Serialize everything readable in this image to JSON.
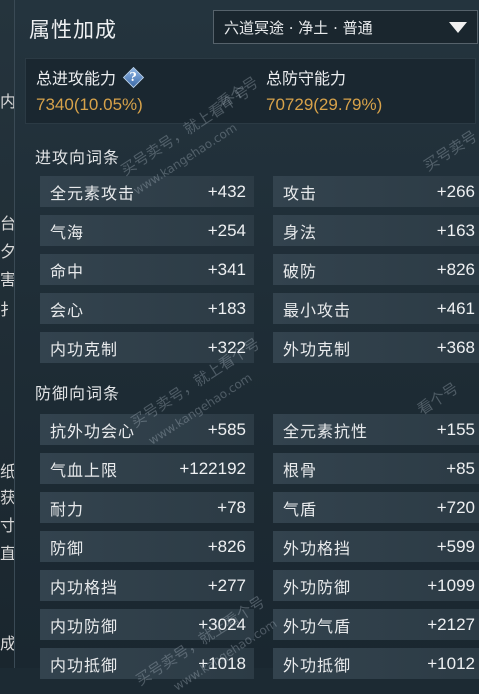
{
  "left_strip": [
    "内",
    "台",
    "夕",
    "害",
    "扌",
    "纸",
    "获",
    "寸",
    "直",
    "成"
  ],
  "header": {
    "title": "属性加成",
    "dropdown_value": "六道冥途 · 净土 · 普通"
  },
  "summary": {
    "attack_label": "总进攻能力",
    "attack_value": "7340(10.05%)",
    "defense_label": "总防守能力",
    "defense_value": "70729(29.79%)"
  },
  "attack_section": {
    "title": "进攻向词条",
    "rows": [
      [
        {
          "name": "全元素攻击",
          "value": "+432"
        },
        {
          "name": "攻击",
          "value": "+266"
        }
      ],
      [
        {
          "name": "气海",
          "value": "+254"
        },
        {
          "name": "身法",
          "value": "+163"
        }
      ],
      [
        {
          "name": "命中",
          "value": "+341"
        },
        {
          "name": "破防",
          "value": "+826"
        }
      ],
      [
        {
          "name": "会心",
          "value": "+183"
        },
        {
          "name": "最小攻击",
          "value": "+461"
        }
      ],
      [
        {
          "name": "内功克制",
          "value": "+322"
        },
        {
          "name": "外功克制",
          "value": "+368"
        }
      ]
    ]
  },
  "defense_section": {
    "title": "防御向词条",
    "rows": [
      [
        {
          "name": "抗外功会心",
          "value": "+585"
        },
        {
          "name": "全元素抗性",
          "value": "+155"
        }
      ],
      [
        {
          "name": "气血上限",
          "value": "+122192"
        },
        {
          "name": "根骨",
          "value": "+85"
        }
      ],
      [
        {
          "name": "耐力",
          "value": "+78"
        },
        {
          "name": "气盾",
          "value": "+720"
        }
      ],
      [
        {
          "name": "防御",
          "value": "+826"
        },
        {
          "name": "外功格挡",
          "value": "+599"
        }
      ],
      [
        {
          "name": "内功格挡",
          "value": "+277"
        },
        {
          "name": "外功防御",
          "value": "+1099"
        }
      ],
      [
        {
          "name": "内功防御",
          "value": "+3024"
        },
        {
          "name": "外功气盾",
          "value": "+2127"
        }
      ],
      [
        {
          "name": "内功抵御",
          "value": "+1018"
        },
        {
          "name": "外功抵御",
          "value": "+1012"
        }
      ]
    ]
  },
  "watermarks": [
    "买号卖号，就上看个号",
    "www.kangehao.com",
    "看个号",
    "买号卖号，就上看个号",
    "www.kangehao.com",
    "买号卖号，就上看个号",
    "www.kangehao.com",
    "买号卖号",
    "看个号"
  ]
}
